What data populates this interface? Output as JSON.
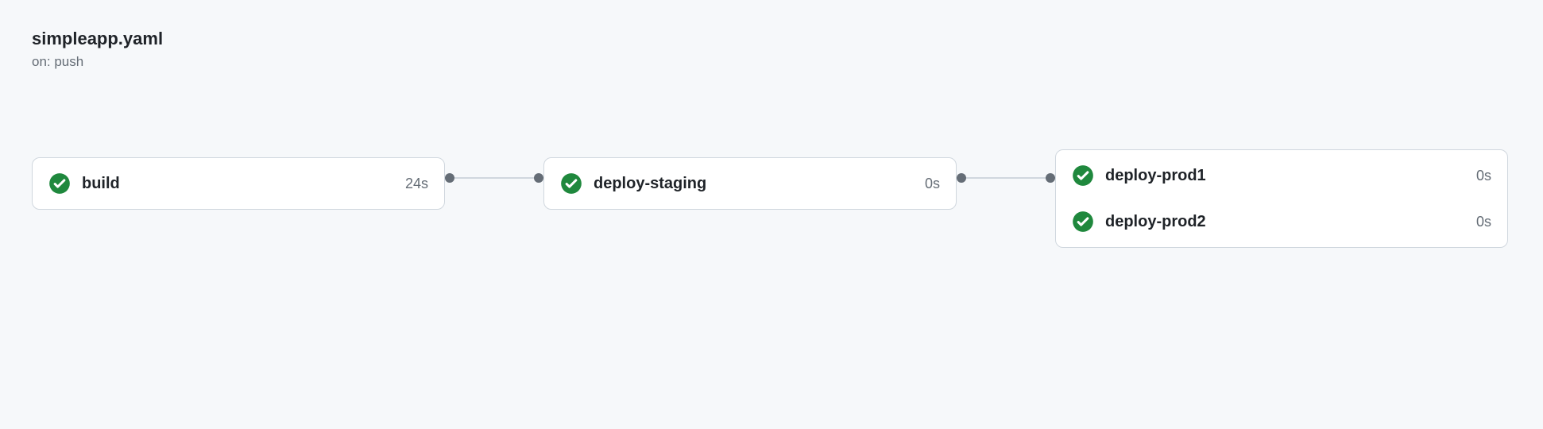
{
  "workflow": {
    "title": "simpleapp.yaml",
    "trigger": "on: push"
  },
  "columns": [
    {
      "jobs": [
        {
          "name": "build",
          "status": "success",
          "duration": "24s"
        }
      ]
    },
    {
      "jobs": [
        {
          "name": "deploy-staging",
          "status": "success",
          "duration": "0s"
        }
      ]
    },
    {
      "jobs": [
        {
          "name": "deploy-prod1",
          "status": "success",
          "duration": "0s"
        },
        {
          "name": "deploy-prod2",
          "status": "success",
          "duration": "0s"
        }
      ]
    }
  ],
  "colors": {
    "success": "#1f883d",
    "page_bg": "#f6f8fa",
    "card_bg": "#ffffff",
    "border": "#d0d7de",
    "text": "#1f2328",
    "muted": "#656d76"
  }
}
